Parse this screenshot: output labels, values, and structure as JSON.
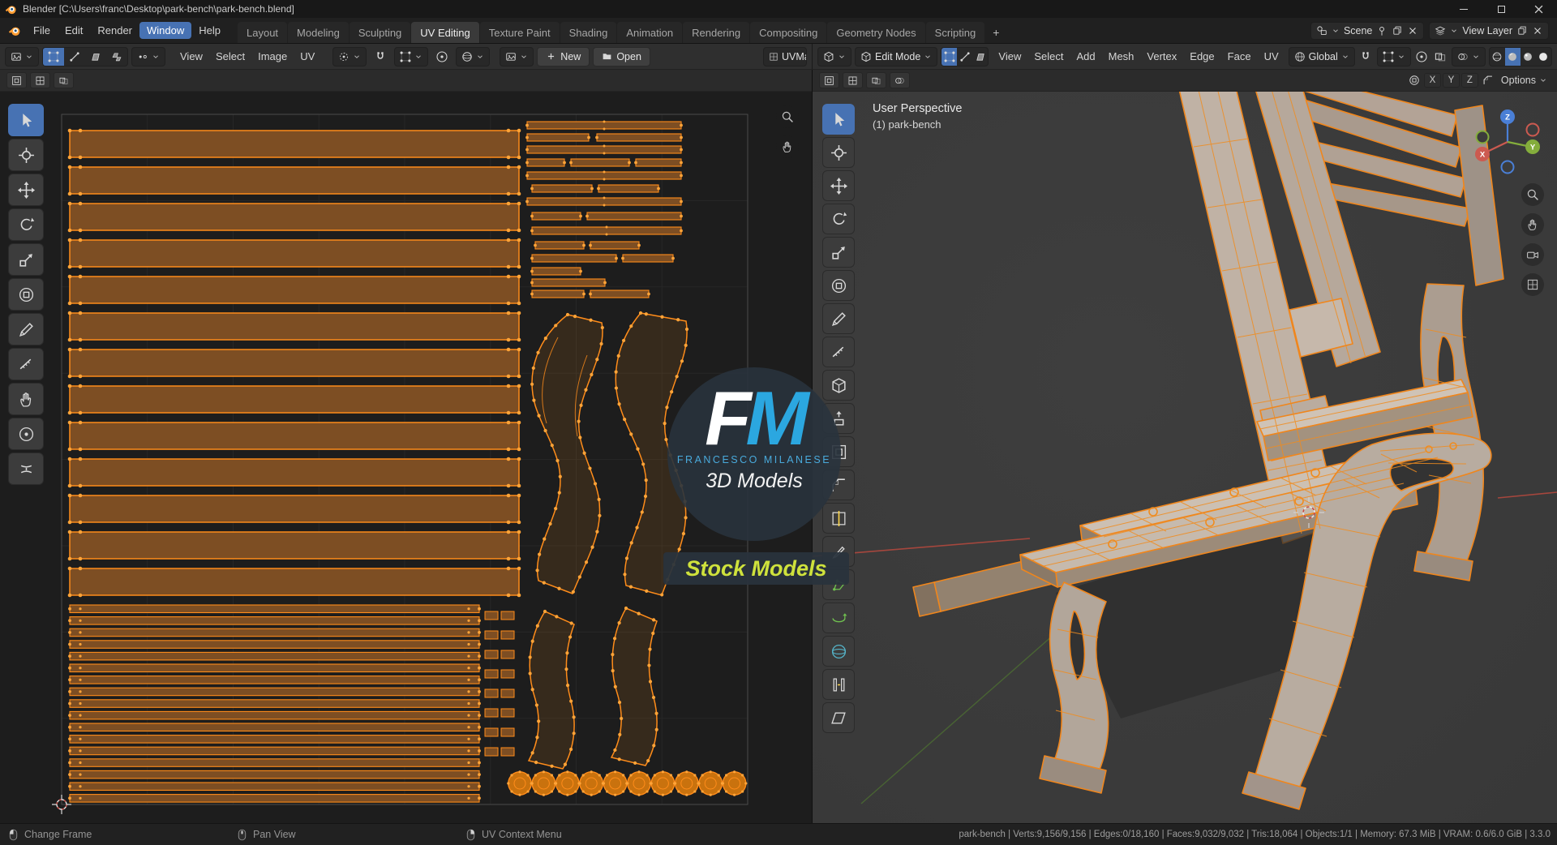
{
  "window": {
    "title": "Blender [C:\\Users\\franc\\Desktop\\park-bench\\park-bench.blend]"
  },
  "topbar": {
    "menus": [
      {
        "label": "File"
      },
      {
        "label": "Edit"
      },
      {
        "label": "Render"
      },
      {
        "label": "Window",
        "highlight": true
      },
      {
        "label": "Help"
      }
    ],
    "workspaces": [
      {
        "label": "Layout"
      },
      {
        "label": "Modeling"
      },
      {
        "label": "Sculpting"
      },
      {
        "label": "UV Editing",
        "active": true
      },
      {
        "label": "Texture Paint"
      },
      {
        "label": "Shading"
      },
      {
        "label": "Animation"
      },
      {
        "label": "Rendering"
      },
      {
        "label": "Compositing"
      },
      {
        "label": "Geometry Nodes"
      },
      {
        "label": "Scripting"
      }
    ],
    "add_tab": "+",
    "scene_field": "Scene",
    "view_layer_field": "View Layer"
  },
  "uv_editor": {
    "menus": [
      {
        "label": "View"
      },
      {
        "label": "Select"
      },
      {
        "label": "Image"
      },
      {
        "label": "UV"
      }
    ],
    "new_button": "New",
    "open_button": "Open",
    "uv_map_field": "UVMap",
    "tools": [
      {
        "name": "tweak-select",
        "icon": "select",
        "active": true
      },
      {
        "name": "cursor",
        "icon": "cursor"
      },
      {
        "name": "move",
        "icon": "move"
      },
      {
        "name": "rotate",
        "icon": "rotate"
      },
      {
        "name": "scale",
        "icon": "scale"
      },
      {
        "name": "transform",
        "icon": "transform"
      },
      {
        "name": "annotate",
        "icon": "annotate"
      },
      {
        "name": "measure",
        "icon": "measure"
      },
      {
        "name": "grab",
        "icon": "hand"
      },
      {
        "name": "relax",
        "icon": "prop"
      },
      {
        "name": "pinch",
        "icon": "pinch"
      }
    ]
  },
  "viewport": {
    "mode_selector": "Edit Mode",
    "menus": [
      {
        "label": "View"
      },
      {
        "label": "Select"
      },
      {
        "label": "Add"
      },
      {
        "label": "Mesh"
      },
      {
        "label": "Vertex"
      },
      {
        "label": "Edge"
      },
      {
        "label": "Face"
      },
      {
        "label": "UV"
      }
    ],
    "orientation": "Global",
    "options_button": "Options",
    "axis_toggles": [
      {
        "label": "X"
      },
      {
        "label": "Y"
      },
      {
        "label": "Z"
      }
    ],
    "overlay": {
      "view_name": "User Perspective",
      "object_name": "(1) park-bench"
    },
    "gizmo": {
      "x": "X",
      "y": "Y",
      "z": "Z"
    },
    "tools": [
      {
        "name": "tweak-select",
        "icon": "select",
        "active": true
      },
      {
        "name": "cursor",
        "icon": "cursor"
      },
      {
        "name": "move",
        "icon": "move"
      },
      {
        "name": "rotate",
        "icon": "rotate"
      },
      {
        "name": "scale",
        "icon": "scale"
      },
      {
        "name": "transform",
        "icon": "transform"
      },
      {
        "name": "annotate",
        "icon": "annotate"
      },
      {
        "name": "measure",
        "icon": "measure"
      },
      {
        "name": "add-cube",
        "icon": "cube"
      },
      {
        "name": "extrude-region",
        "icon": "extrude"
      },
      {
        "name": "inset-faces",
        "icon": "inset"
      },
      {
        "name": "bevel",
        "icon": "bevel"
      },
      {
        "name": "loop-cut",
        "icon": "loopcut"
      },
      {
        "name": "knife",
        "icon": "knife"
      },
      {
        "name": "poly-build",
        "icon": "poly",
        "tint": "#6fbf4f"
      },
      {
        "name": "spin",
        "icon": "spin",
        "tint": "#6fbf4f"
      },
      {
        "name": "smooth",
        "icon": "sphere",
        "tint": "#55b4c9"
      },
      {
        "name": "edge-slide",
        "icon": "slide"
      },
      {
        "name": "shear",
        "icon": "shear"
      }
    ]
  },
  "watermark": {
    "letter_f": "F",
    "letter_m": "M",
    "name": "FRANCESCO MILANESE",
    "tagline": "3D Models",
    "badge": "Stock Models"
  },
  "statusbar": {
    "hints": [
      {
        "button": "left",
        "label": "Change Frame"
      },
      {
        "button": "middle",
        "label": "Pan View"
      },
      {
        "button": "right",
        "label": "UV Context Menu"
      }
    ],
    "stats": "park-bench | Verts:9,156/9,156 | Edges:0/18,160 | Faces:9,032/9,032 | Tris:18,064 | Objects:1/1 | Memory: 67.3 MiB | VRAM: 0.6/6.0 GiB | 3.3.0"
  },
  "colors": {
    "accent": "#4772b3",
    "selection_orange": "#ff8c1a",
    "uv_fill_brown": "#7d4e23",
    "logo_blue": "#2ba7e0",
    "badge_text": "#cfe23c"
  }
}
